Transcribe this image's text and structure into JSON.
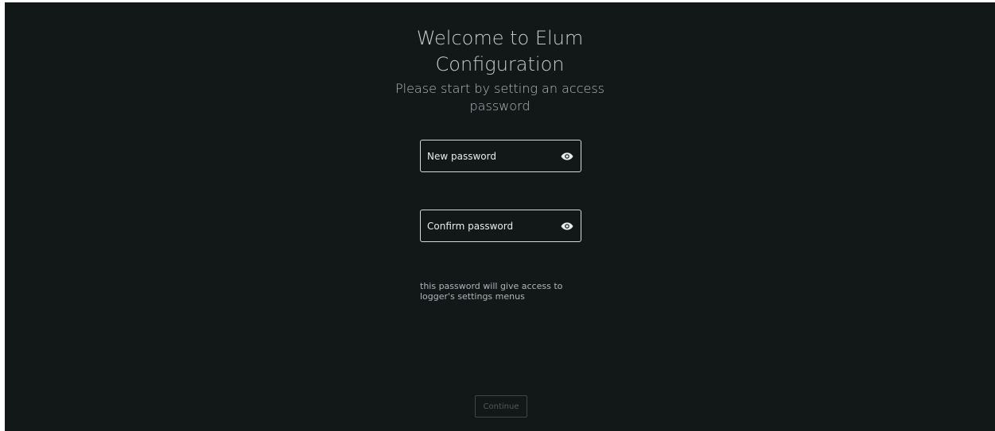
{
  "header": {
    "title_lines": [
      "Welcome to Elum",
      "Configuration"
    ],
    "subtitle_lines": [
      "Please start by setting an access",
      "password"
    ]
  },
  "form": {
    "new_password": {
      "placeholder": "New password",
      "value": "",
      "icon": "eye-icon"
    },
    "confirm_password": {
      "placeholder": "Confirm password",
      "value": "",
      "icon": "eye-icon"
    },
    "hint_lines": [
      "this password will give access to",
      "logger's settings menus"
    ]
  },
  "actions": {
    "continue_label": "Continue",
    "continue_enabled": false
  },
  "colors": {
    "background": "#121717",
    "text": "#c4ccd0",
    "field_border": "#d5dadc",
    "disabled_button_text": "#505a5d"
  }
}
